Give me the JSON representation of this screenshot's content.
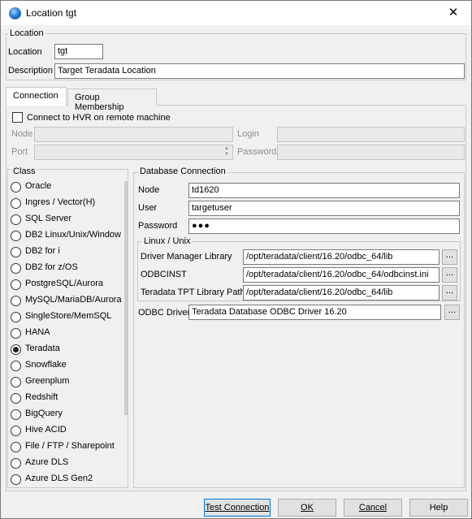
{
  "window": {
    "title": "Location tgt",
    "close_glyph": "✕",
    "icon": "hvr-globe-icon"
  },
  "location_group": {
    "title": "Location",
    "location_label": "Location",
    "location_value": "tgt",
    "description_label": "Description",
    "description_value": "Target Teradata Location"
  },
  "tabs": [
    {
      "label": "Connection",
      "active": true
    },
    {
      "label": "Group Membership",
      "active": false
    }
  ],
  "remote": {
    "checkbox_label": "Connect to HVR on remote machine",
    "checked": false,
    "node_label": "Node",
    "port_label": "Port",
    "login_label": "Login",
    "password_label": "Password",
    "node_value": "",
    "port_value": "",
    "login_value": "",
    "password_value": ""
  },
  "class_list": {
    "title": "Class",
    "selected": "Teradata",
    "items": [
      "Oracle",
      "Ingres / Vector(H)",
      "SQL Server",
      "DB2 Linux/Unix/Window",
      "DB2 for i",
      "DB2 for z/OS",
      "PostgreSQL/Aurora",
      "MySQL/MariaDB/Aurora",
      "SingleStore/MemSQL",
      "HANA",
      "Teradata",
      "Snowflake",
      "Greenplum",
      "Redshift",
      "BigQuery",
      "Hive ACID",
      "File / FTP / Sharepoint",
      "Azure DLS",
      "Azure DLS Gen2"
    ]
  },
  "db_connection": {
    "title": "Database Connection",
    "node_label": "Node",
    "node_value": "td1620",
    "user_label": "User",
    "user_value": "targetuser",
    "password_label": "Password",
    "password_value": "●●●"
  },
  "linux_unix": {
    "title": "Linux / Unix",
    "driver_manager_label": "Driver Manager Library",
    "driver_manager_value": "/opt/teradata/client/16.20/odbc_64/lib",
    "odbcinst_label": "ODBCINST",
    "odbcinst_value": "/opt/teradata/client/16.20/odbc_64/odbcinst.ini",
    "tpt_label": "Teradata TPT Library Path",
    "tpt_value": "/opt/teradata/client/16.20/odbc_64/lib"
  },
  "odbc": {
    "label": "ODBC Driver",
    "value": "Teradata Database ODBC Driver 16.20"
  },
  "browse_label": "...",
  "buttons": {
    "test_connection": "Test Connection",
    "ok": "OK",
    "cancel": "Cancel",
    "help": "Help"
  }
}
